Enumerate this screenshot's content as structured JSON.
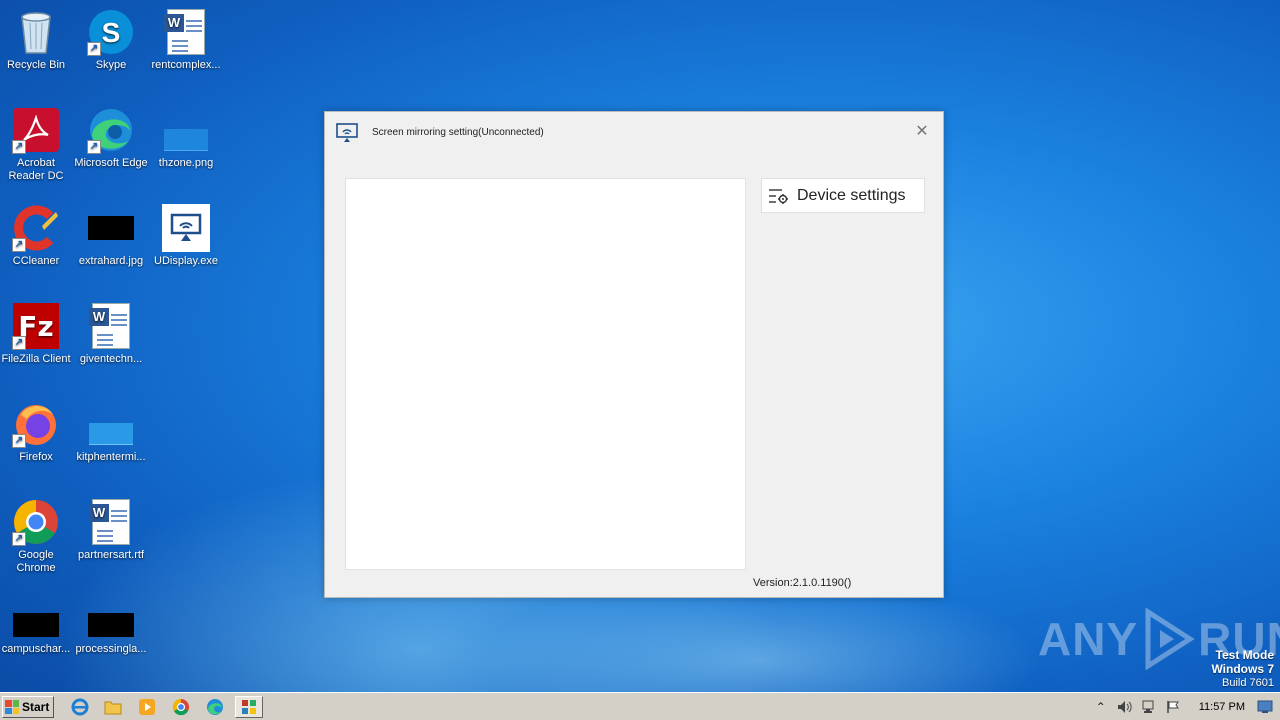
{
  "desktop": {
    "icons": [
      {
        "label": "Recycle Bin"
      },
      {
        "label": "Skype"
      },
      {
        "label": "rentcomplex..."
      },
      {
        "label": "Acrobat Reader DC"
      },
      {
        "label": "Microsoft Edge"
      },
      {
        "label": "thzone.png"
      },
      {
        "label": "CCleaner"
      },
      {
        "label": "extrahard.jpg"
      },
      {
        "label": "UDisplay.exe"
      },
      {
        "label": "FileZilla Client"
      },
      {
        "label": "giventechn..."
      },
      {
        "label": "Firefox"
      },
      {
        "label": "kitphentermi..."
      },
      {
        "label": "Google Chrome"
      },
      {
        "label": "partnersart.rtf"
      },
      {
        "label": "campuschar..."
      },
      {
        "label": "processingla..."
      }
    ]
  },
  "dialog": {
    "title": "Screen mirroring setting(Unconnected)",
    "close_glyph": "✕",
    "device_settings_label": "Device settings",
    "version": "Version:2.1.0.1190()"
  },
  "watermark": {
    "text_left": "ANY",
    "text_right": "RUN"
  },
  "test_mode": {
    "line1": "Test Mode",
    "line2": "Windows 7",
    "line3": "Build 7601"
  },
  "taskbar": {
    "start_label": "Start",
    "clock": "11:57 PM"
  },
  "colors": {
    "desktop_blue": "#1b82e0",
    "dialog_bg": "#f0f0f0",
    "taskbar_bg": "#d4d0c8"
  }
}
